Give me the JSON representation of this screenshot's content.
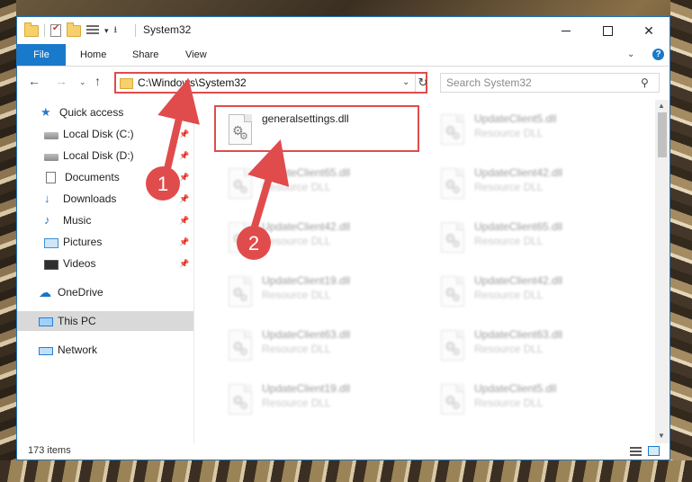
{
  "window": {
    "title": "System32"
  },
  "ribbon": {
    "tabs": [
      "File",
      "Home",
      "Share",
      "View"
    ],
    "help": "?"
  },
  "address": {
    "path": "C:\\Windows\\System32",
    "search_placeholder": "Search System32"
  },
  "nav": {
    "items": [
      {
        "label": "Quick access",
        "icon": "star-icon"
      },
      {
        "label": "Local Disk (C:)",
        "icon": "drive-icon",
        "pinned": true
      },
      {
        "label": "Local Disk (D:)",
        "icon": "drive-icon",
        "pinned": true
      },
      {
        "label": "Documents",
        "icon": "document-icon",
        "pinned": true
      },
      {
        "label": "Downloads",
        "icon": "download-icon",
        "pinned": true
      },
      {
        "label": "Music",
        "icon": "music-icon",
        "pinned": true
      },
      {
        "label": "Pictures",
        "icon": "picture-icon",
        "pinned": true
      },
      {
        "label": "Videos",
        "icon": "video-icon",
        "pinned": true
      },
      {
        "label": "OneDrive",
        "icon": "cloud-icon"
      },
      {
        "label": "This PC",
        "icon": "computer-icon",
        "selected": true
      },
      {
        "label": "Network",
        "icon": "network-icon"
      }
    ]
  },
  "files": [
    {
      "name": "generalsettings.dll",
      "type": ""
    },
    {
      "name": "UpdateClient5.dll",
      "type": "Resource DLL"
    },
    {
      "name": "UpdateClient65.dll",
      "type": "Resource DLL"
    },
    {
      "name": "UpdateClient42.dll",
      "type": "Resource DLL"
    },
    {
      "name": "UpdateClient42.dll",
      "type": "Resource DLL"
    },
    {
      "name": "UpdateClient65.dll",
      "type": "Resource DLL"
    },
    {
      "name": "UpdateClient19.dll",
      "type": "Resource DLL"
    },
    {
      "name": "UpdateClient42.dll",
      "type": "Resource DLL"
    },
    {
      "name": "UpdateClient63.dll",
      "type": "Resource DLL"
    },
    {
      "name": "UpdateClient63.dll",
      "type": "Resource DLL"
    },
    {
      "name": "UpdateClient19.dll",
      "type": "Resource DLL"
    },
    {
      "name": "UpdateClient5.dll",
      "type": "Resource DLL"
    }
  ],
  "status": {
    "item_count": "173 items"
  },
  "annotations": {
    "step1": "1",
    "step2": "2",
    "color": "#e04c4c"
  }
}
